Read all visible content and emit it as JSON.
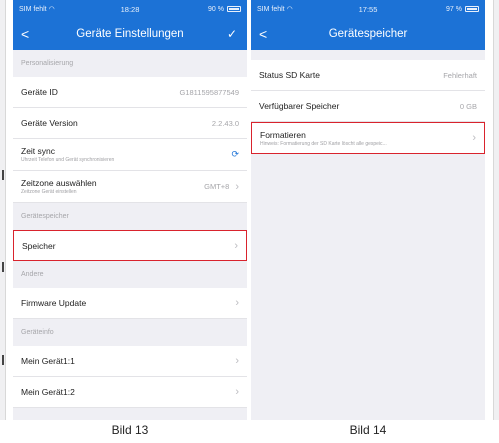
{
  "screen1": {
    "status": {
      "carrier": "SIM fehlt",
      "time": "18:28",
      "battery": "90 %"
    },
    "nav": {
      "back": "<",
      "title": "Geräte Einstellungen",
      "confirm": "✓"
    },
    "sections": {
      "personalisierung": "Personalisierung",
      "geraetespeicher": "Gerätespeicher",
      "andere": "Andere",
      "geraeteinfo": "Geräteinfo"
    },
    "rows": {
      "device_id": {
        "label": "Geräte ID",
        "value": "G1811595877549"
      },
      "device_version": {
        "label": "Geräte Version",
        "value": "2.2.43.0"
      },
      "time_sync": {
        "label": "Zeit sync",
        "sub": "Uhrzeit Telefon und Gerät synchronisieren",
        "icon": "sync-icon"
      },
      "timezone": {
        "label": "Zeitzone auswählen",
        "sub": "Zeitzone Gerät einstellen",
        "value": "GMT+8"
      },
      "storage": {
        "label": "Speicher"
      },
      "firmware": {
        "label": "Firmware Update"
      },
      "device1": {
        "label": "Mein Gerät1:1"
      },
      "device2": {
        "label": "Mein Gerät1:2"
      }
    },
    "caption": "Bild 13"
  },
  "screen2": {
    "status": {
      "carrier": "SIM fehlt",
      "time": "17:55",
      "battery": "97 %"
    },
    "nav": {
      "back": "<",
      "title": "Gerätespeicher"
    },
    "rows": {
      "sd_status": {
        "label": "Status SD Karte",
        "value": "Fehlerhaft"
      },
      "available": {
        "label": "Verfügbarer Speicher",
        "value": "0 GB"
      },
      "format": {
        "label": "Formatieren",
        "sub": "Hinweis: Formatierung der SD Karte löscht alle gespeic..."
      }
    },
    "caption": "Bild 14"
  },
  "colors": {
    "accent": "#1c72d6",
    "highlight": "#d9232d",
    "background": "#efeff4"
  }
}
